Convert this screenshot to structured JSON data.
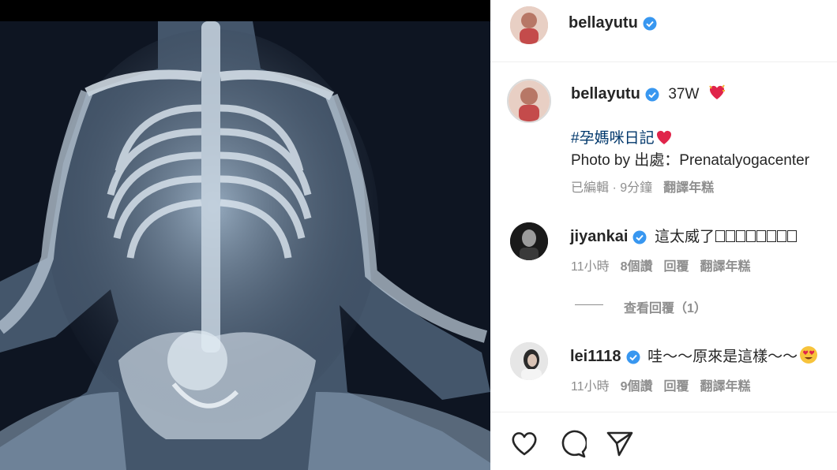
{
  "post": {
    "author": "bellayutu",
    "caption_likes": "37W",
    "caption_emoji": "heart-emoji",
    "hashtag": "#孕媽咪日記",
    "photo_credit": "Photo by 出處：Prenatalyogacenter",
    "edited_time": "已編輯 · 9分鐘",
    "translate": "翻譯年糕"
  },
  "comments": [
    {
      "user": "jiyankai",
      "text": "這太威了",
      "time": "11小時",
      "likes": "8個讚",
      "reply": "回覆",
      "translate": "翻譯年糕"
    },
    {
      "user": "lei1118",
      "text": "哇～～原來是這樣～～",
      "time": "11小時",
      "likes": "9個讚",
      "reply": "回覆",
      "translate": "翻譯年糕"
    }
  ],
  "view_replies": "查看回覆（1）",
  "colors": {
    "verified": "#3897f0",
    "link": "#00376b",
    "muted": "#8e8e8e"
  }
}
